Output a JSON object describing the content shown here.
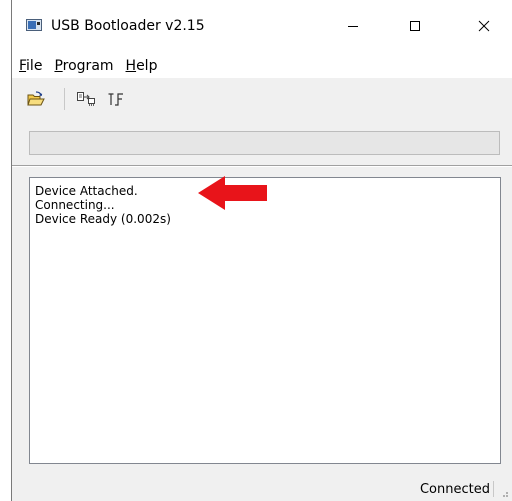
{
  "window": {
    "title": "USB Bootloader v2.15",
    "icon": "app-window-icon"
  },
  "title_buttons": {
    "minimize_icon": "minimize-icon",
    "maximize_icon": "maximize-icon",
    "close_icon": "close-icon"
  },
  "menu": {
    "items": [
      {
        "mnemonic": "F",
        "rest": "ile"
      },
      {
        "mnemonic": "P",
        "rest": "rogram"
      },
      {
        "mnemonic": "H",
        "rest": "elp"
      }
    ]
  },
  "toolbar": {
    "icons": [
      "open-folder-icon",
      "program-device-icon",
      "reset-device-icon"
    ]
  },
  "progress": {
    "value_percent": 0
  },
  "log": {
    "lines": [
      "Device Attached.",
      "Connecting...",
      "Device Ready (0.002s)"
    ]
  },
  "annotation": {
    "icon": "red-arrow-icon",
    "color": "#e8141a"
  },
  "status": {
    "text": "Connected"
  },
  "colors": {
    "progress_fill": "#06b025",
    "window_bg": "#f0f0f0"
  }
}
